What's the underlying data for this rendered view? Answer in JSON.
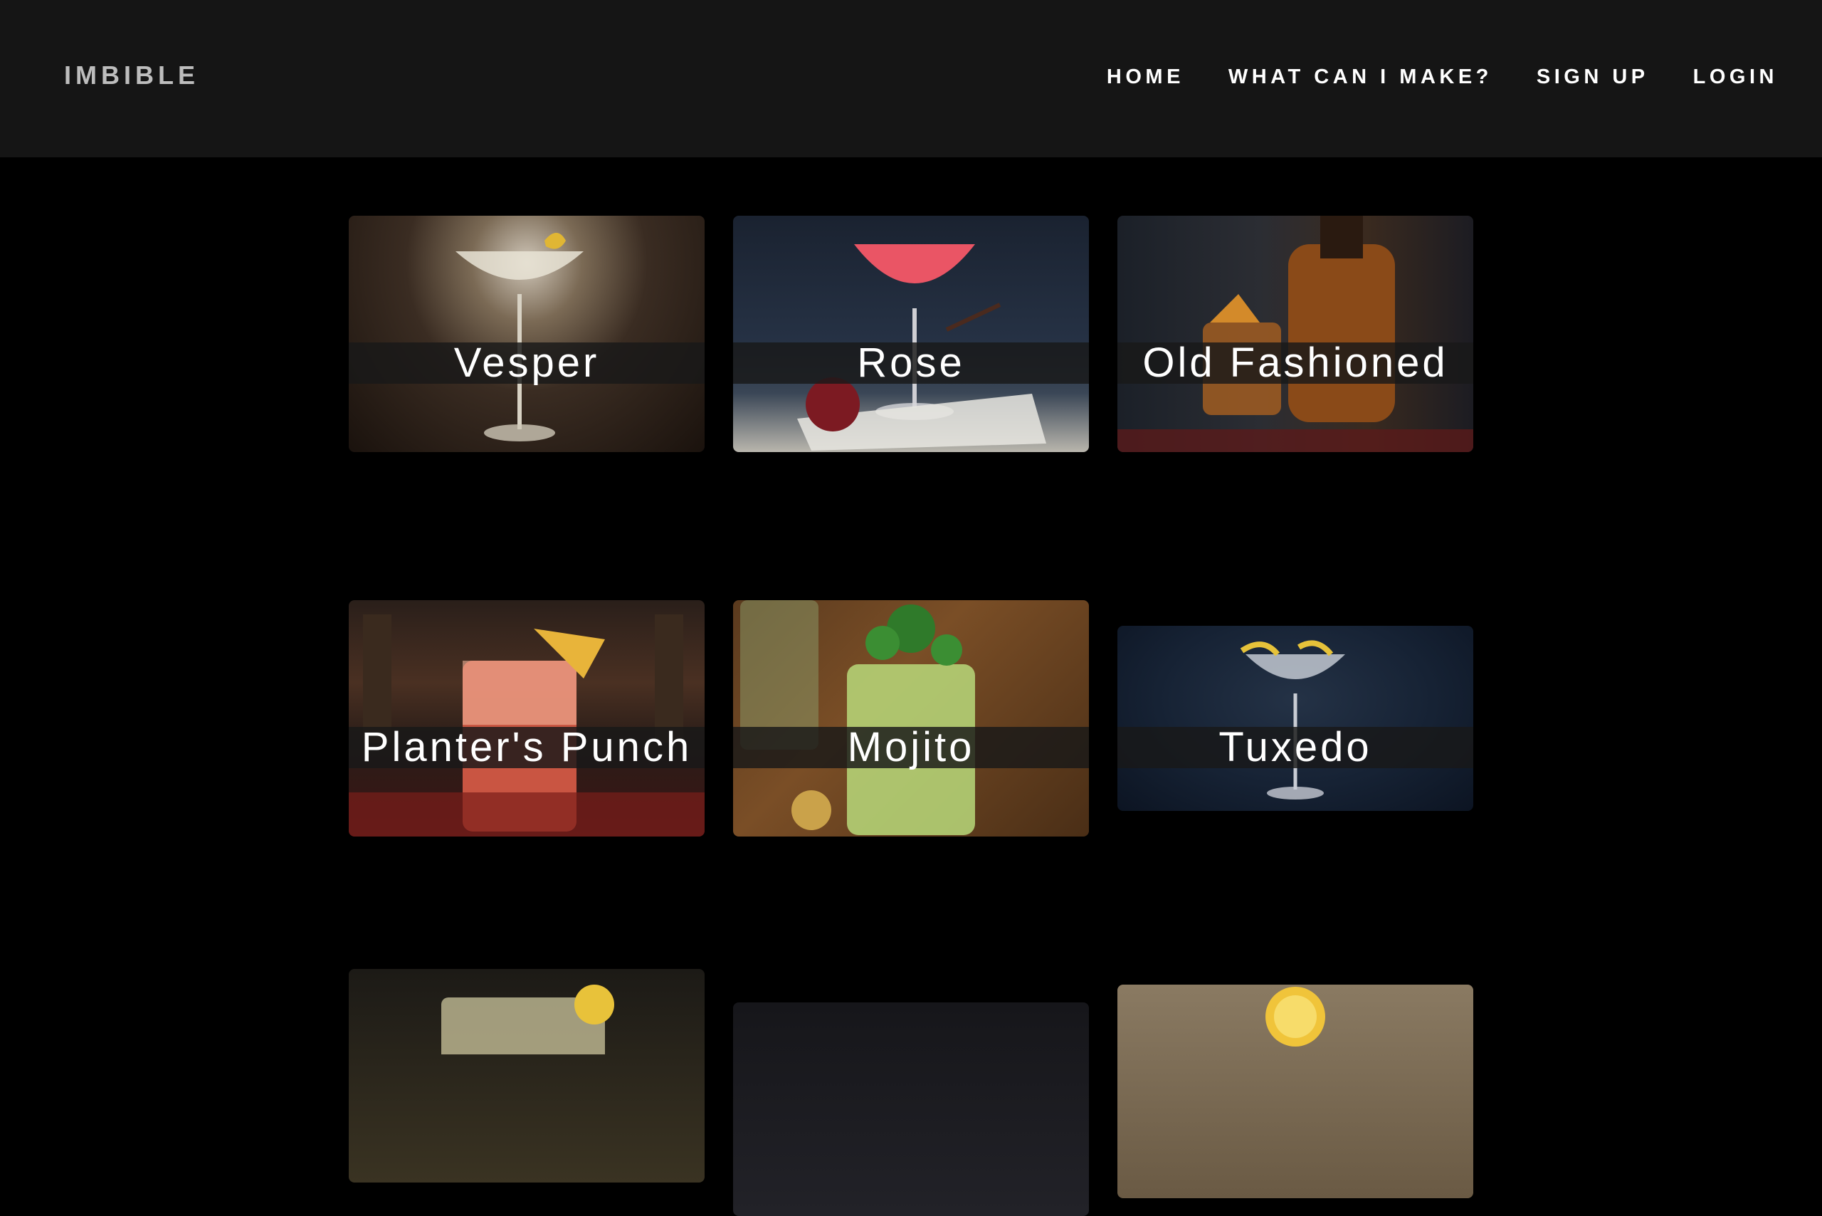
{
  "brand": "IMBIBLE",
  "nav": {
    "home": "HOME",
    "what_can_i_make": "WHAT CAN I MAKE?",
    "sign_up": "SIGN UP",
    "login": "LOGIN"
  },
  "cocktails": [
    {
      "name": "Vesper"
    },
    {
      "name": "Rose"
    },
    {
      "name": "Old Fashioned"
    },
    {
      "name": "Planter's Punch"
    },
    {
      "name": "Mojito"
    },
    {
      "name": "Tuxedo"
    }
  ],
  "colors": {
    "navbar_bg": "#151515",
    "page_bg": "#000000",
    "brand_text": "#bdbdbd",
    "label_band": "#191919"
  }
}
